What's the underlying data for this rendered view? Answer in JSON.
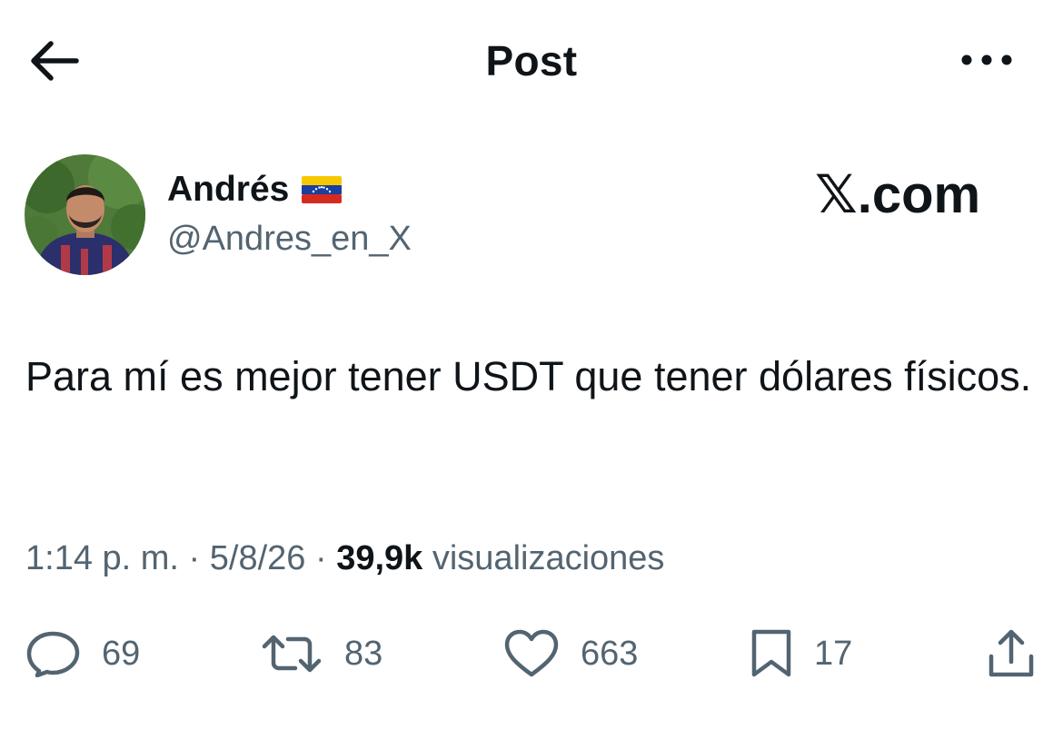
{
  "header": {
    "title": "Post"
  },
  "brand": {
    "label": ".com",
    "logo_glyph": "𝕏"
  },
  "author": {
    "name": "Andrés",
    "handle": "@Andres_en_X",
    "flag": "venezuela-flag",
    "avatar": "profile-photo"
  },
  "tweet": {
    "text": "Para mí es mejor tener USDT que tener dólares físicos."
  },
  "meta": {
    "time": "1:14 p. m.",
    "sep1": " · ",
    "date": "5/8/26",
    "sep2": " · ",
    "views_count": "39,9k",
    "views_label": " visualizaciones"
  },
  "actions": {
    "replies": "69",
    "reposts": "83",
    "likes": "663",
    "bookmarks": "17"
  },
  "colors": {
    "text": "#0f1419",
    "secondary": "#536471",
    "background": "#ffffff"
  }
}
